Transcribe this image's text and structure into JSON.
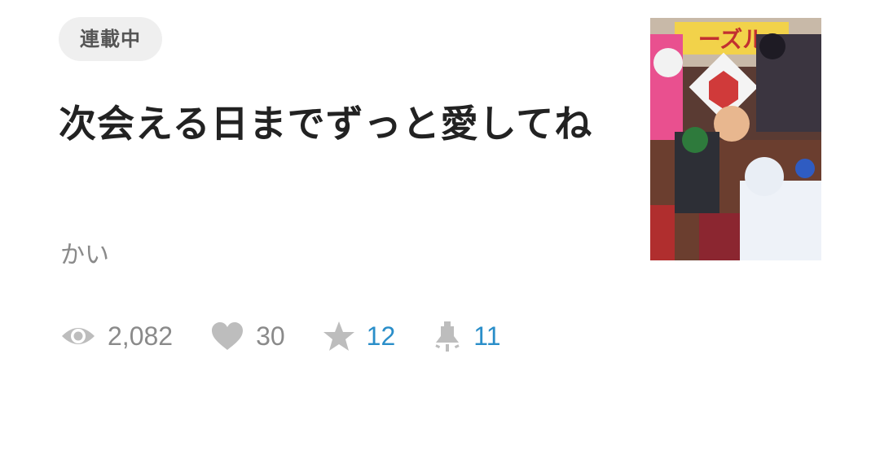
{
  "status_badge": "連載中",
  "title": "次会える日までずっと愛してね",
  "author": "かい",
  "stats": {
    "views": "2,082",
    "likes": "30",
    "favorites": "12",
    "comments": "11"
  },
  "cover": {
    "title_text": "ーズル"
  },
  "colors": {
    "stat_gray": "#8a8a8a",
    "stat_blue": "#2a8ec9",
    "icon_gray": "#bdbdbd",
    "badge_bg": "#efefef"
  },
  "icons": [
    "eye-icon",
    "heart-icon",
    "star-icon",
    "bell-icon"
  ]
}
